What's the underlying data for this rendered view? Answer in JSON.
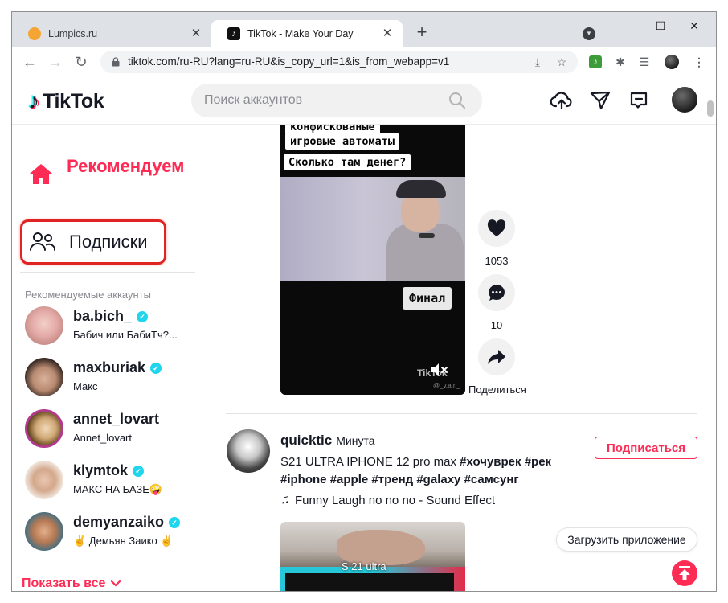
{
  "browser": {
    "tabs": [
      {
        "label": "Lumpics.ru",
        "active": false
      },
      {
        "label": "TikTok - Make Your Day",
        "active": true
      }
    ],
    "url": "tiktok.com/ru-RU?lang=ru-RU&is_copy_url=1&is_from_webapp=v1",
    "icons": [
      "back-icon",
      "forward-icon",
      "reload-icon",
      "lock-icon",
      "install-icon",
      "star-icon",
      "puzzle-icon",
      "media-icon",
      "menu-icon"
    ]
  },
  "tiktok": {
    "logo_text": "TikTok",
    "search_placeholder": "Поиск аккаунтов",
    "nav": {
      "recommended": "Рекомендуем",
      "following": "Подписки"
    },
    "suggested_heading": "Рекомендуемые аккаунты",
    "accounts": [
      {
        "username": "ba.bich_",
        "nickname": "Бабич или БабиТч?...",
        "verified": true
      },
      {
        "username": "maxburiak",
        "nickname": "Макс",
        "verified": true
      },
      {
        "username": "annet_lovart",
        "nickname": "Annet_lovart",
        "verified": false
      },
      {
        "username": "klymtok",
        "nickname": "МАКС НА БАЗЕ🤪",
        "verified": true
      },
      {
        "username": "demyanzaiko",
        "nickname": "✌ Демьян Заико ✌",
        "verified": true
      }
    ],
    "show_all": "Показать все",
    "video1": {
      "captions": [
        "конфискованые",
        "игровые автоматы",
        "Сколько там денег?"
      ],
      "overlay_button": "Финал",
      "watermark": "TikTok",
      "watermark_user": "@_v.a.r._",
      "likes": "1053",
      "comments": "10",
      "share_label": "Поделиться"
    },
    "post2": {
      "username": "quicktic",
      "time": "Минута",
      "description_plain": "S21 ULTRA IPHONE 12 pro max ",
      "hashtags_line1": [
        "#хочуврек",
        "#рек"
      ],
      "hashtags_line2": [
        "#iphone",
        "#apple",
        "#тренд",
        "#galaxy",
        "#самсунг"
      ],
      "sound": "Funny Laugh no no no - Sound Effect",
      "follow_label": "Подписаться",
      "video_text": "S 21 ultra"
    },
    "get_app": "Загрузить приложение",
    "colors": {
      "brand": "#fe2c55",
      "verified": "#20d5ec",
      "highlight": "#e02424"
    }
  }
}
